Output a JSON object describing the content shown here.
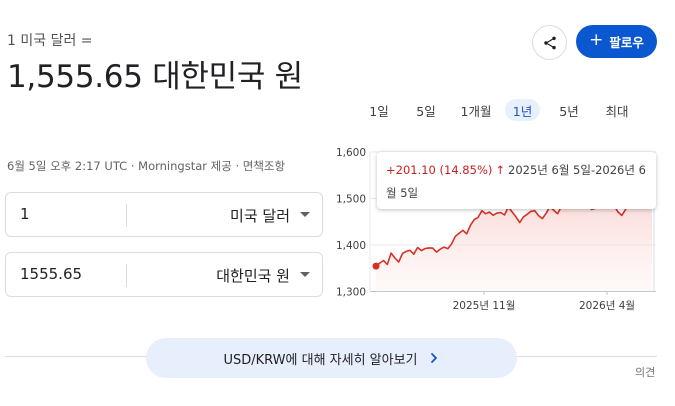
{
  "header": {
    "subtitle": "1 미국 달러 =",
    "value": "1,555.65 대한민국 원",
    "meta": "6월 5일 오후 2:17 UTC · Morningstar 제공 · 면책조항"
  },
  "actions": {
    "share_icon": "share-icon",
    "follow_label": "팔로우",
    "follow_icon": "+",
    "accent": "#0b57d0"
  },
  "converter": {
    "from": {
      "amount": "1",
      "currency": "미국 달러"
    },
    "to": {
      "amount": "1555.65",
      "currency": "대한민국 원"
    }
  },
  "ranges": {
    "tabs": [
      "1일",
      "5일",
      "1개월",
      "1년",
      "5년",
      "최대"
    ],
    "active": "1년"
  },
  "tooltip": {
    "change": "+201.10 (14.85%)",
    "arrow": "↑",
    "period": "2025년 6월 5일-2026년 6월 5일"
  },
  "chart_data": {
    "type": "area",
    "title": "",
    "yticks": [
      "1,600",
      "1,500",
      "1,400",
      "1,300"
    ],
    "ylim": [
      1300,
      1600
    ],
    "xticks": [
      "2025년 11월",
      "2026년 4월"
    ],
    "series_color": "#d93025",
    "grid": true,
    "start_value": 1354.55,
    "end_value": 1555.65,
    "values": [
      1354.55,
      1360,
      1368,
      1362,
      1380,
      1372,
      1366,
      1378,
      1385,
      1390,
      1384,
      1392,
      1388,
      1395,
      1390,
      1392,
      1386,
      1395,
      1393,
      1392,
      1405,
      1415,
      1424,
      1433,
      1428,
      1440,
      1455,
      1462,
      1470,
      1466,
      1472,
      1468,
      1466,
      1470,
      1467,
      1478,
      1470,
      1462,
      1452,
      1458,
      1466,
      1475,
      1470,
      1462,
      1458,
      1472,
      1480,
      1475,
      1470,
      1478,
      1490,
      1495,
      1485,
      1480,
      1490,
      1497,
      1486,
      1475,
      1480,
      1490,
      1500,
      1487,
      1492,
      1480,
      1470,
      1465,
      1480,
      1500,
      1510,
      1495,
      1487,
      1498,
      1510,
      1555.65
    ]
  },
  "learn_more": {
    "label": "USD/KRW에 대해 자세히 알아보기",
    "icon": "chevron-right-icon"
  },
  "feedback_label": "의견"
}
